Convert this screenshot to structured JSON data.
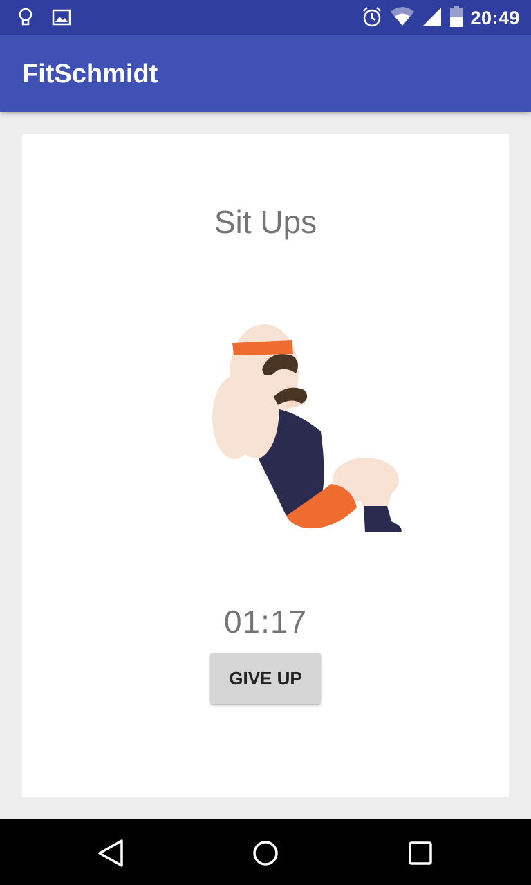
{
  "status_bar": {
    "time": "20:49",
    "icons": [
      "lightbulb-icon",
      "image-icon",
      "alarm-icon",
      "wifi-icon",
      "signal-icon",
      "battery-icon"
    ]
  },
  "app_bar": {
    "title": "FitSchmidt",
    "color": "#3f51b5"
  },
  "exercise": {
    "name": "Sit Ups",
    "illustration": "sit-up-man-illustration",
    "timer": "01:17",
    "give_up_label": "GIVE UP"
  },
  "nav_bar": {
    "buttons": [
      "back-icon",
      "home-icon",
      "recents-icon"
    ]
  }
}
